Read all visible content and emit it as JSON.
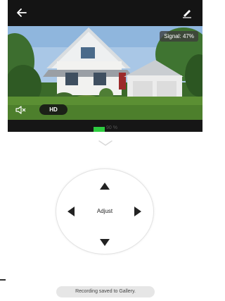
{
  "header": {
    "back_icon": "arrow-left-icon",
    "edit_icon": "pencil-icon"
  },
  "video": {
    "signal_label": "Signal: 47%",
    "quality_label": "HD",
    "mute_icon": "speaker-muted-icon"
  },
  "status": {
    "battery_label": "90 %",
    "battery_level": 0.9,
    "battery_color": "#2ecc40"
  },
  "controls": {
    "center_label": "Adjust",
    "collapse_icon": "chevron-down-icon",
    "up_icon": "triangle-up-icon",
    "down_icon": "triangle-down-icon",
    "left_icon": "triangle-left-icon",
    "right_icon": "triangle-right-icon"
  },
  "toast": {
    "message": "Recording saved to Gallery."
  }
}
